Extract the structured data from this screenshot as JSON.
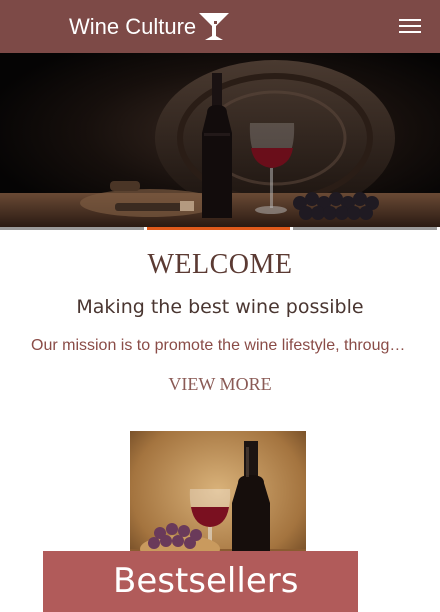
{
  "header": {
    "brand": "Wine Culture",
    "logo_icon": "wine-glass-icon",
    "menu_icon": "hamburger-menu-icon",
    "background_color": "#7d4a47"
  },
  "hero": {
    "image": "wine-bottle-glass-barrel-photo"
  },
  "slider": {
    "slides": 3,
    "active_index": 1,
    "active_color": "#e05a1b"
  },
  "welcome": {
    "title": "WELCOME",
    "subtitle": "Making the best wine possible",
    "mission": "Our mission is to promote the wine lifestyle, through the appreciation of fine wine and good food.",
    "view_more": "VIEW MORE"
  },
  "product": {
    "image": "wine-bottle-glass-grapes-photo"
  },
  "bestsellers": {
    "label": "Bestsellers",
    "background_color": "#b15b5a"
  }
}
